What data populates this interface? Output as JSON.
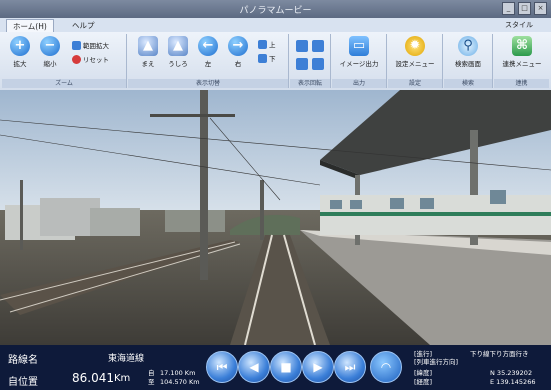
{
  "window": {
    "title": "パノラマムービー"
  },
  "tabs": [
    {
      "label": "ホーム(H)"
    },
    {
      "label": "ヘルプ"
    }
  ],
  "style_label": "スタイル",
  "ribbon": {
    "zoom": {
      "label": "ズーム",
      "zoom_in": "拡大",
      "zoom_out": "縮小",
      "restore": "範囲拡大",
      "reset": "リセット"
    },
    "view": {
      "label": "表示切替",
      "front": "まえ",
      "back": "うしろ",
      "left": "左",
      "right": "右",
      "up": "上",
      "down": "下"
    },
    "rotate": {
      "label": "表示回転"
    },
    "output": {
      "label": "出力",
      "image_output": "イメージ出力"
    },
    "settings": {
      "label": "設定",
      "settings_menu": "設定メニュー"
    },
    "search": {
      "label": "検索",
      "search_screen": "検索画面"
    },
    "link": {
      "label": "連携",
      "link_menu": "連携メニュー"
    }
  },
  "status": {
    "route_label": "路線名",
    "route_value": "東海道線",
    "position_label": "自位置",
    "position_value": "86.041",
    "position_unit": "Km",
    "from_label": "自",
    "from_value": "17.100 Km",
    "to_label": "至",
    "to_value": "104.570 Km",
    "direction_label": "[進行]",
    "direction_sub": "[列車進行方向]",
    "direction_value": "下り線下り方面行き",
    "lat_label": "[緯度]",
    "lat_value": "N 35.239202",
    "lon_label": "[経度]",
    "lon_value": "E 139.145266"
  },
  "icons": {
    "nav_first": "skip-back-icon",
    "nav_prev": "prev-icon",
    "nav_stop": "stop-icon",
    "nav_next": "next-icon",
    "nav_last": "skip-forward-icon",
    "wifi": "wifi-icon"
  }
}
